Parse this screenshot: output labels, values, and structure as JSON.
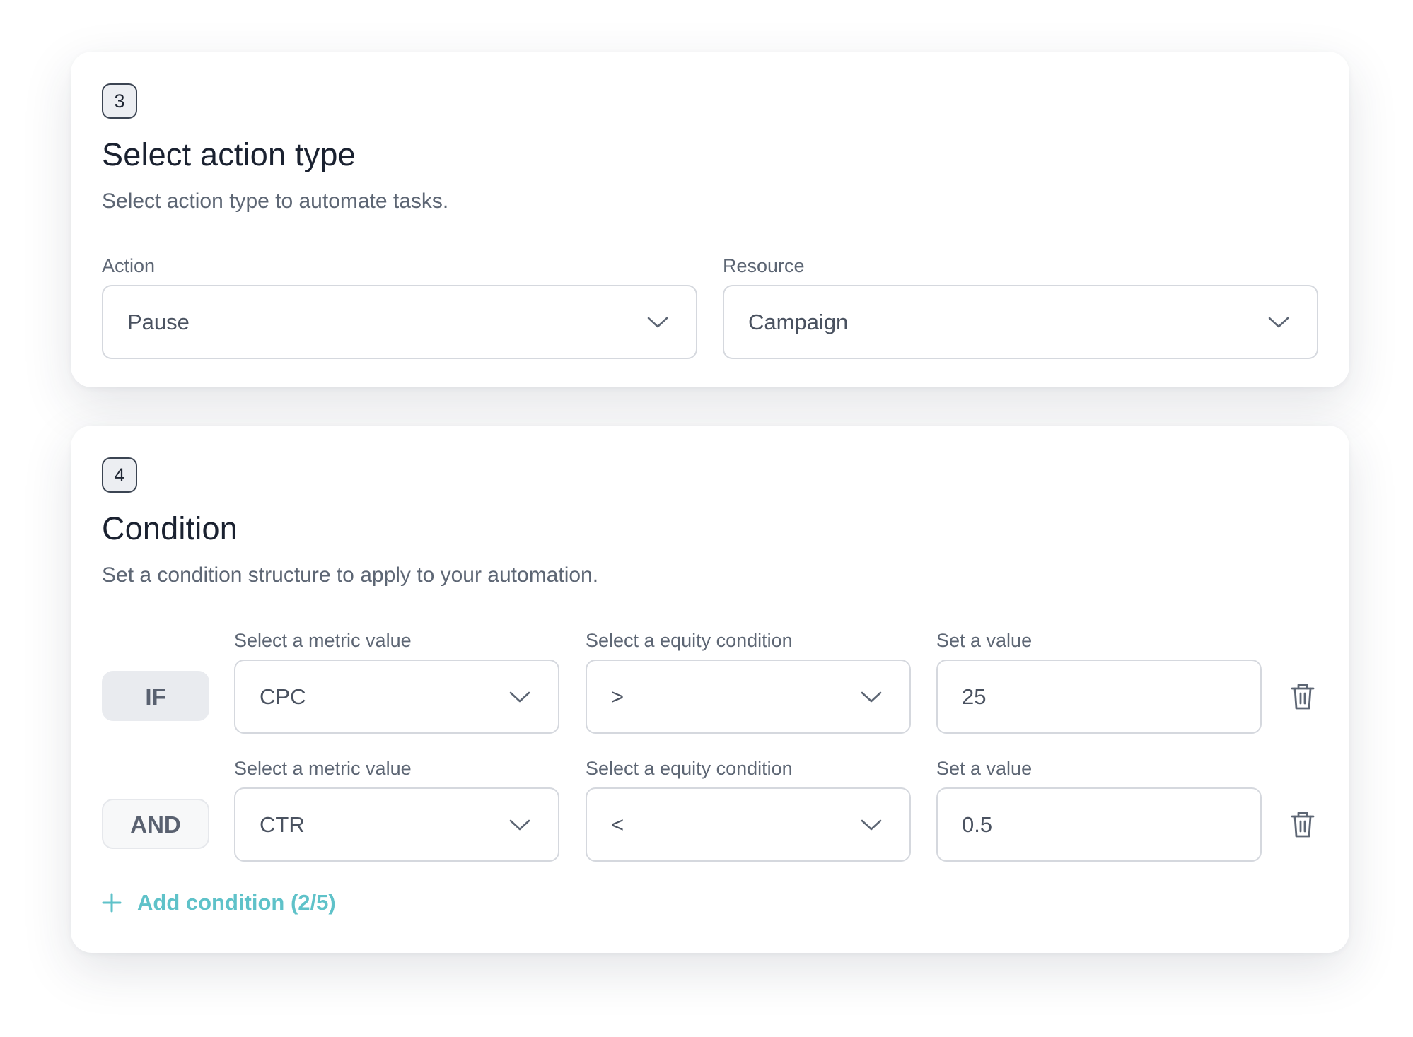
{
  "action_step": {
    "number": "3",
    "title": "Select action type",
    "subtitle": "Select action type to automate tasks.",
    "action": {
      "label": "Action",
      "value": "Pause"
    },
    "resource": {
      "label": "Resource",
      "value": "Campaign"
    }
  },
  "condition_step": {
    "number": "4",
    "title": "Condition",
    "subtitle": "Set a condition structure to apply to your automation.",
    "rows": [
      {
        "logic": "IF",
        "metric_label": "Select a metric value",
        "metric_value": "CPC",
        "equity_label": "Select a equity condition",
        "equity_value": ">",
        "value_label": "Set a value",
        "value": "25"
      },
      {
        "logic": "AND",
        "metric_label": "Select a metric value",
        "metric_value": "CTR",
        "equity_label": "Select a equity condition",
        "equity_value": "<",
        "value_label": "Set a value",
        "value": "0.5"
      }
    ],
    "add_condition_label": "Add condition (2/5)"
  },
  "icons": {
    "dropdown": "chevron-down-icon",
    "delete": "trash-icon",
    "add": "plus-icon"
  },
  "colors": {
    "accent": "#5fc2c9",
    "text_primary": "#1a2130",
    "text_secondary": "#5d6674",
    "border": "#d5d8de"
  }
}
